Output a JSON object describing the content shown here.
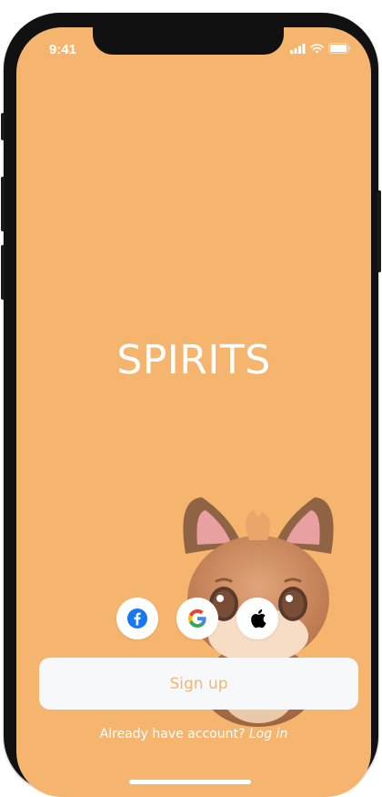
{
  "status_bar": {
    "time": "9:41",
    "icons": [
      "signal-icon",
      "wifi-icon",
      "battery-icon"
    ]
  },
  "app": {
    "title": "SPIRITS"
  },
  "social_login": {
    "buttons": [
      {
        "name": "facebook-icon",
        "color": "#1877F2"
      },
      {
        "name": "google-icon",
        "colors": [
          "#4285F4",
          "#EA4335",
          "#FBBC05",
          "#34A853"
        ]
      },
      {
        "name": "apple-icon",
        "color": "#000000"
      }
    ]
  },
  "signup_button": {
    "label": "Sign up"
  },
  "login_prompt": {
    "text": "Already have account?",
    "link": "Log in"
  },
  "colors": {
    "background": "#F6B56E",
    "button_bg": "#F7F8FA",
    "accent": "#F6B56E"
  }
}
